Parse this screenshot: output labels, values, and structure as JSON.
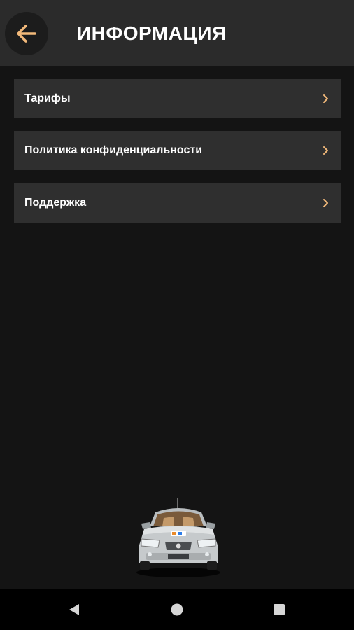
{
  "header": {
    "title": "ИНФОРМАЦИЯ",
    "back_icon": "arrow-left-icon"
  },
  "menu": {
    "items": [
      {
        "label": "Тарифы",
        "icon": "chevron-right-icon"
      },
      {
        "label": "Политика конфиденциальности",
        "icon": "chevron-right-icon"
      },
      {
        "label": "Поддержка",
        "icon": "chevron-right-icon"
      }
    ]
  },
  "footer_image": "taxi-car",
  "system_nav": {
    "back": "triangle-back-icon",
    "home": "circle-home-icon",
    "recents": "square-recents-icon"
  },
  "colors": {
    "accent": "#f2b97a",
    "background": "#141414",
    "app_bar": "#2b2b2b",
    "card": "#2f2f2f",
    "nav_bar": "#000000"
  }
}
